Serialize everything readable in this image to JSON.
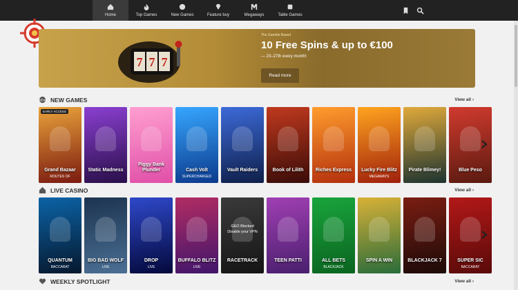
{
  "nav": {
    "items": [
      {
        "label": "Home",
        "icon": "home-icon",
        "active": true
      },
      {
        "label": "Top Games",
        "icon": "flame-icon",
        "active": false
      },
      {
        "label": "New Games",
        "icon": "new-icon",
        "active": false
      },
      {
        "label": "Feature buy",
        "icon": "gem-icon",
        "active": false
      },
      {
        "label": "Megaways",
        "icon": "megaways-icon",
        "active": false
      },
      {
        "label": "Table Games",
        "icon": "table-icon",
        "active": false
      }
    ],
    "bookmark_icon": "bookmark-icon",
    "search_icon": "search-icon"
  },
  "banner": {
    "kicker": "The Gamble Based",
    "title": "10 Free Spins & up to €100",
    "subtitle": "— 23–27th every month!",
    "button": "Read more"
  },
  "sections": {
    "new_games": {
      "title": "NEW GAMES",
      "view_all": "View all",
      "tiles": [
        {
          "name": "Grand Bazaar",
          "sub": "ROUTES OF",
          "badge": "EARLY ACCESS",
          "c1": "#7b1a10",
          "c2": "#e9a23a"
        },
        {
          "name": "Static Madness",
          "sub": "",
          "badge": "",
          "c1": "#2a0f4a",
          "c2": "#8a3fd0"
        },
        {
          "name": "Piggy Bank Plunder",
          "sub": "",
          "badge": "",
          "c1": "#e04fa8",
          "c2": "#ff9fd0"
        },
        {
          "name": "Cash Volt",
          "sub": "SUPERCHARGED",
          "badge": "",
          "c1": "#0c3a8c",
          "c2": "#36a6ff"
        },
        {
          "name": "Vault Raiders",
          "sub": "",
          "badge": "",
          "c1": "#0f1f4a",
          "c2": "#3c6ad8"
        },
        {
          "name": "Book of Lilith",
          "sub": "",
          "badge": "",
          "c1": "#3a0c08",
          "c2": "#c0391e"
        },
        {
          "name": "Riches Express",
          "sub": "",
          "badge": "",
          "c1": "#b4300d",
          "c2": "#ff9c2d"
        },
        {
          "name": "Lucky Fire Blitz",
          "sub": "MEGAWAYS",
          "badge": "",
          "c1": "#a0200c",
          "c2": "#ffa41f"
        },
        {
          "name": "Pirate Blimey!",
          "sub": "",
          "badge": "",
          "c1": "#1c3330",
          "c2": "#e0a93b"
        },
        {
          "name": "Blue Peso",
          "sub": "",
          "badge": "",
          "c1": "#5a1a10",
          "c2": "#d13a2e"
        }
      ]
    },
    "live_casino": {
      "title": "LIVE CASINO",
      "view_all": "View all",
      "tiles": [
        {
          "name": "QUANTUM",
          "sub": "BACCARAT",
          "c1": "#06182e",
          "c2": "#0b63a6"
        },
        {
          "name": "BIG BAD WOLF",
          "sub": "LIVE",
          "c1": "#4b6f94",
          "c2": "#1c3450"
        },
        {
          "name": "DROP",
          "sub": "LIVE",
          "c1": "#04093d",
          "c2": "#2e48c9"
        },
        {
          "name": "BUFFALO BLITZ",
          "sub": "LIVE",
          "c1": "#41156b",
          "c2": "#b12c63"
        },
        {
          "name": "RACETRACK",
          "sub": "",
          "geo_title": "GEO Blocked",
          "geo_sub": "Disable your VPN",
          "c1": "#151515",
          "c2": "#3a3a3a"
        },
        {
          "name": "TEEN PATTI",
          "sub": "",
          "c1": "#4a1f6e",
          "c2": "#a03fb3"
        },
        {
          "name": "ALL BETS",
          "sub": "BLACKJACK",
          "c1": "#0a6420",
          "c2": "#19a43c"
        },
        {
          "name": "SPIN A WIN",
          "sub": "",
          "c1": "#2a6c3a",
          "c2": "#d8b137"
        },
        {
          "name": "BLACKJACK 7",
          "sub": "",
          "c1": "#1c0a08",
          "c2": "#7a1d12"
        },
        {
          "name": "SUPER SIC",
          "sub": "BACCARAT",
          "c1": "#5a0a0a",
          "c2": "#b21818"
        }
      ]
    },
    "weekly": {
      "title": "WEEKLY SPOTLIGHT",
      "view_all": "View all"
    }
  }
}
